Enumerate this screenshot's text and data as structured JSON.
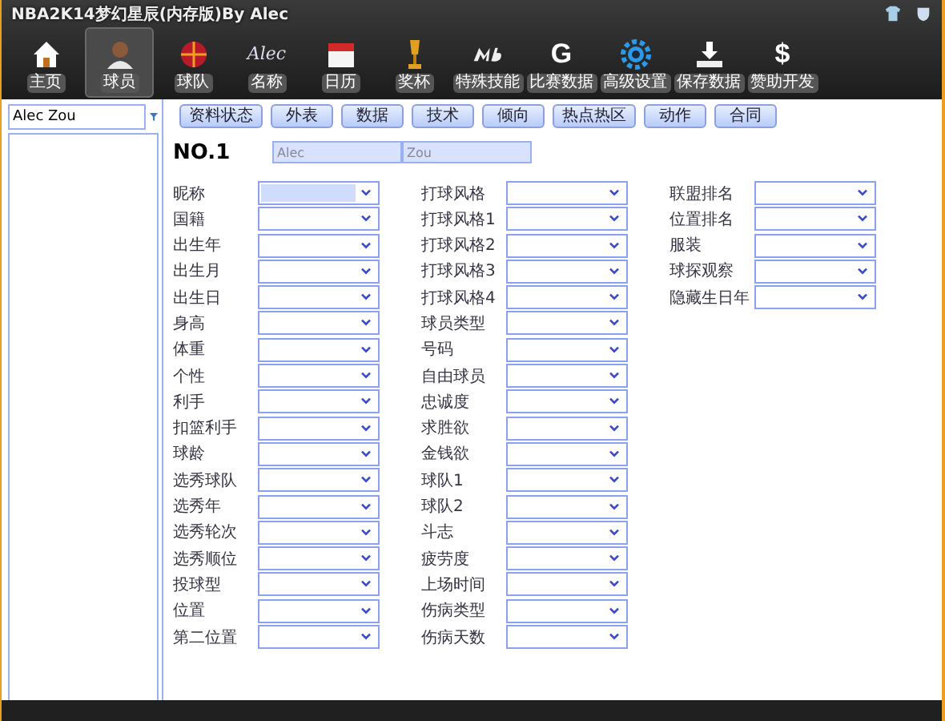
{
  "window": {
    "title": "NBA2K14梦幻星辰(内存版)By Alec"
  },
  "nav": [
    {
      "label": "主页",
      "kind": "home",
      "selected": false
    },
    {
      "label": "球员",
      "kind": "player",
      "selected": true
    },
    {
      "label": "球队",
      "kind": "team",
      "selected": false
    },
    {
      "label": "名称",
      "kind": "signature",
      "glyph": "Alec",
      "selected": false
    },
    {
      "label": "日历",
      "kind": "calendar",
      "selected": false
    },
    {
      "label": "奖杯",
      "kind": "trophy",
      "selected": false
    },
    {
      "label": "特殊技能",
      "kind": "logo",
      "selected": false
    },
    {
      "label": "比赛数据",
      "kind": "letter",
      "glyph": "G",
      "selected": false
    },
    {
      "label": "高级设置",
      "kind": "gear",
      "selected": false
    },
    {
      "label": "保存数据",
      "kind": "download",
      "selected": false
    },
    {
      "label": "赞助开发",
      "kind": "letter",
      "glyph": "$",
      "selected": false
    }
  ],
  "search": {
    "value": "Alec Zou"
  },
  "tabs": [
    {
      "label": "资料状态"
    },
    {
      "label": "外表"
    },
    {
      "label": "数据"
    },
    {
      "label": "技术"
    },
    {
      "label": "倾向"
    },
    {
      "label": "热点热区"
    },
    {
      "label": "动作"
    },
    {
      "label": "合同"
    }
  ],
  "player": {
    "number": "NO.1",
    "first_name": "Alec",
    "last_name": "Zou"
  },
  "columns": [
    [
      {
        "label": "昵称",
        "selected": true
      },
      {
        "label": "国籍",
        "selected": false
      },
      {
        "label": "出生年",
        "selected": false
      },
      {
        "label": "出生月",
        "selected": false
      },
      {
        "label": "出生日",
        "selected": false
      },
      {
        "label": "身高",
        "selected": false
      },
      {
        "label": "体重",
        "selected": false
      },
      {
        "label": "个性",
        "selected": false
      },
      {
        "label": "利手",
        "selected": false
      },
      {
        "label": "扣篮利手",
        "selected": false
      },
      {
        "label": "球龄",
        "selected": false
      },
      {
        "label": "选秀球队",
        "selected": false
      },
      {
        "label": "选秀年",
        "selected": false
      },
      {
        "label": "选秀轮次",
        "selected": false
      },
      {
        "label": "选秀顺位",
        "selected": false
      },
      {
        "label": "投球型",
        "selected": false
      },
      {
        "label": "位置",
        "selected": false
      },
      {
        "label": "第二位置",
        "selected": false
      }
    ],
    [
      {
        "label": "打球风格",
        "selected": false
      },
      {
        "label": "打球风格1",
        "selected": false
      },
      {
        "label": "打球风格2",
        "selected": false
      },
      {
        "label": "打球风格3",
        "selected": false
      },
      {
        "label": "打球风格4",
        "selected": false
      },
      {
        "label": "球员类型",
        "selected": false
      },
      {
        "label": "号码",
        "selected": false
      },
      {
        "label": "自由球员",
        "selected": false
      },
      {
        "label": "忠诚度",
        "selected": false
      },
      {
        "label": "求胜欲",
        "selected": false
      },
      {
        "label": "金钱欲",
        "selected": false
      },
      {
        "label": "球队1",
        "selected": false
      },
      {
        "label": "球队2",
        "selected": false
      },
      {
        "label": "斗志",
        "selected": false
      },
      {
        "label": "疲劳度",
        "selected": false
      },
      {
        "label": "上场时间",
        "selected": false
      },
      {
        "label": "伤病类型",
        "selected": false
      },
      {
        "label": "伤病天数",
        "selected": false
      }
    ],
    [
      {
        "label": "联盟排名",
        "selected": false
      },
      {
        "label": "位置排名",
        "selected": false
      },
      {
        "label": "服装",
        "selected": false
      },
      {
        "label": "球探观察",
        "selected": false
      },
      {
        "label": "隐藏生日年",
        "selected": false
      }
    ]
  ]
}
